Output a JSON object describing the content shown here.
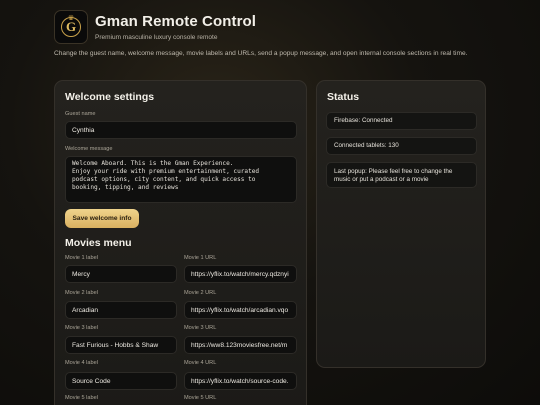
{
  "header": {
    "logo_letter": "G",
    "title": "Gman Remote Control",
    "subtitle": "Premium masculine luxury console remote",
    "intro": "Change the guest name, welcome message, movie labels and URLs, send a popup message, and open internal console sections in real time."
  },
  "welcome": {
    "heading": "Welcome settings",
    "guest_label": "Guest name",
    "guest_value": "Cynthia",
    "message_label": "Welcome message",
    "message_value": "Welcome Aboard. This is the Gman Experience.\nEnjoy your ride with premium entertainment, curated\npodcast options, city content, and quick access to\nbooking, tipping, and reviews",
    "save_label": "Save welcome info"
  },
  "movies": {
    "heading": "Movies menu",
    "items": [
      {
        "label_caption": "Movie 1 label",
        "label_value": "Mercy",
        "url_caption": "Movie 1 URL",
        "url_value": "https://yflix.to/watch/mercy.qdznyi"
      },
      {
        "label_caption": "Movie 2 label",
        "label_value": "Arcadian",
        "url_caption": "Movie 2 URL",
        "url_value": "https://yflix.to/watch/arcadian.vqo"
      },
      {
        "label_caption": "Movie 3 label",
        "label_value": "Fast Furious - Hobbs & Shaw",
        "url_caption": "Movie 3 URL",
        "url_value": "https://ww8.123moviesfree.net/m"
      },
      {
        "label_caption": "Movie 4 label",
        "label_value": "Source Code",
        "url_caption": "Movie 4 URL",
        "url_value": "https://yflix.to/watch/source-code."
      },
      {
        "label_caption": "Movie 5 label",
        "label_value": "",
        "url_caption": "Movie 5 URL",
        "url_value": ""
      }
    ]
  },
  "status": {
    "heading": "Status",
    "firebase": "Firebase: Connected",
    "tablets": "Connected tablets: 130",
    "last_popup": "Last popup: Please feel free to change the music or put a podcast or a movie"
  }
}
